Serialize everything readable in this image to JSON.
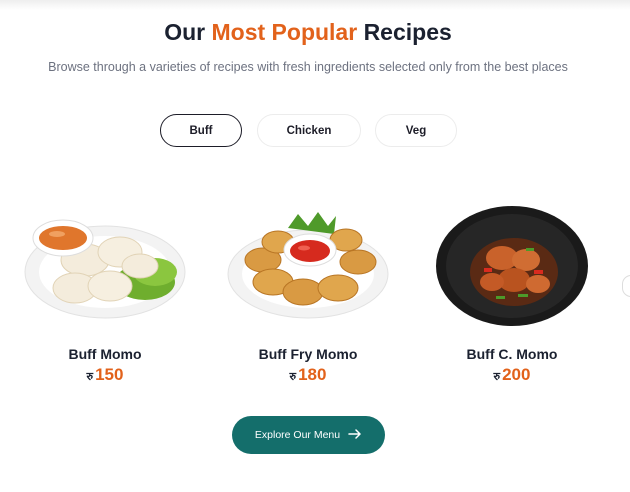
{
  "header": {
    "title_prefix": "Our",
    "title_accent": "Most Popular",
    "title_suffix": "Recipes",
    "subtitle": "Browse through a varieties of recipes with fresh ingredients selected only from the best places"
  },
  "tabs": [
    {
      "label": "Buff",
      "active": true
    },
    {
      "label": "Chicken",
      "active": false
    },
    {
      "label": "Veg",
      "active": false
    }
  ],
  "items": [
    {
      "name": "Buff Momo",
      "currency": "रु",
      "price": "150",
      "image": "momo-plate-image"
    },
    {
      "name": "Buff Fry Momo",
      "currency": "रु",
      "price": "180",
      "image": "fried-momo-plate-image"
    },
    {
      "name": "Buff C. Momo",
      "currency": "रु",
      "price": "200",
      "image": "chilli-momo-bowl-image"
    }
  ],
  "cta": {
    "label": "Explore Our Menu",
    "icon": "arrow-right-icon"
  },
  "colors": {
    "accent": "#e2621b",
    "primary": "#146e6b",
    "text": "#1b2130"
  }
}
